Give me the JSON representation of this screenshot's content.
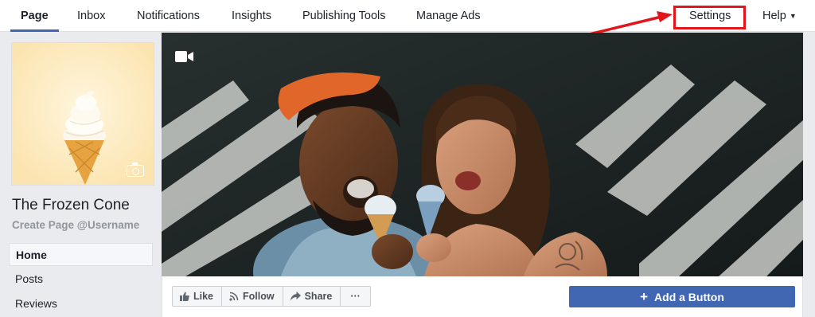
{
  "topnav": {
    "tabs": [
      {
        "label": "Page"
      },
      {
        "label": "Inbox"
      },
      {
        "label": "Notifications"
      },
      {
        "label": "Insights"
      },
      {
        "label": "Publishing Tools"
      },
      {
        "label": "Manage Ads"
      },
      {
        "label": "Settings"
      },
      {
        "label": "Help"
      }
    ],
    "active_tab": "Page",
    "accent_color": "#4267b2",
    "highlight_color": "#e0161b"
  },
  "sidebar": {
    "page_name": "The Frozen Cone",
    "username_link": "Create Page @Username",
    "items": [
      {
        "label": "Home"
      },
      {
        "label": "Posts"
      },
      {
        "label": "Reviews"
      }
    ]
  },
  "cover": {
    "icons": [
      "video-camera-icon",
      "camera-icon"
    ]
  },
  "actions": {
    "like": "Like",
    "follow": "Follow",
    "share": "Share",
    "more": "···",
    "add_button": "Add a Button"
  }
}
